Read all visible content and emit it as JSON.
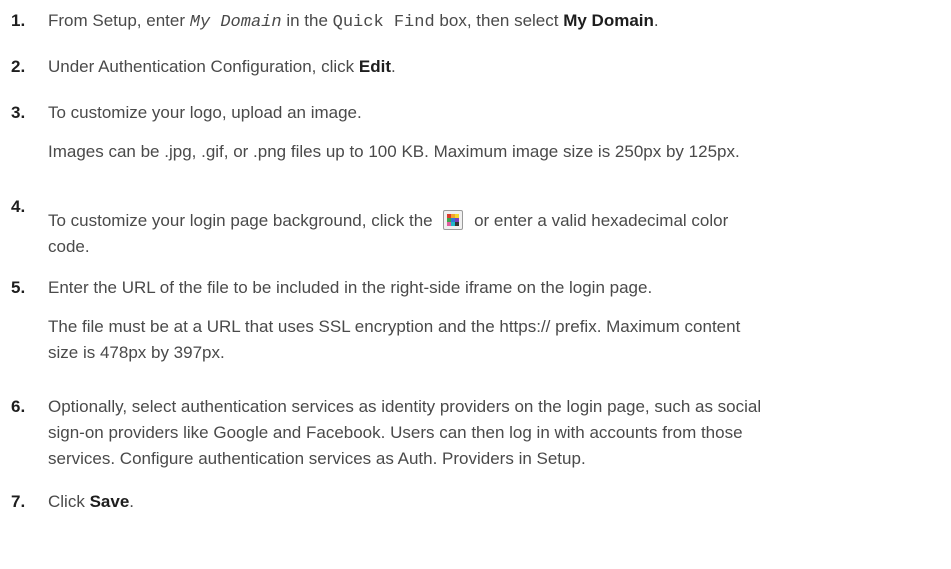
{
  "steps": [
    {
      "number": "1.",
      "parts": {
        "a": "From Setup, enter",
        "b": "My Domain",
        "c": "in the",
        "d": "Quick Find",
        "e": "box, then select",
        "f": "My Domain",
        "g": "."
      }
    },
    {
      "number": "2.",
      "parts": {
        "a": "Under Authentication Configuration, click",
        "b": "Edit",
        "c": "."
      }
    },
    {
      "number": "3.",
      "text": "To customize your logo, upload an image.",
      "note": "Images can be .jpg, .gif, or .png files up to 100 KB. Maximum image size is 250px by 125px."
    },
    {
      "number": "4.",
      "parts": {
        "a": "To customize your login page background, click the",
        "icon": "color-picker-icon",
        "b": "or enter a valid hexadecimal color",
        "c": "code."
      }
    },
    {
      "number": "5.",
      "text": "Enter the URL of the file to be included in the right-side iframe on the login page.",
      "note_line1": "The file must be at a URL that uses SSL encryption and the https:// prefix. Maximum content",
      "note_line2": "size is 478px by 397px."
    },
    {
      "number": "6.",
      "line1": "Optionally, select authentication services as identity providers on the login page, such as social",
      "line2": "sign-on providers like Google and Facebook. Users can then log in with accounts from those",
      "line3": "services. Configure authentication services as Auth. Providers in Setup."
    },
    {
      "number": "7.",
      "parts": {
        "a": "Click",
        "b": "Save",
        "c": "."
      }
    }
  ],
  "picker_colors": [
    "#d93b2b",
    "#f2a22b",
    "#f5d92a",
    "#3aa64a",
    "#2e7bd6",
    "#7d3fb8",
    "#e05ca0",
    "#20b7c9",
    "#333333"
  ]
}
